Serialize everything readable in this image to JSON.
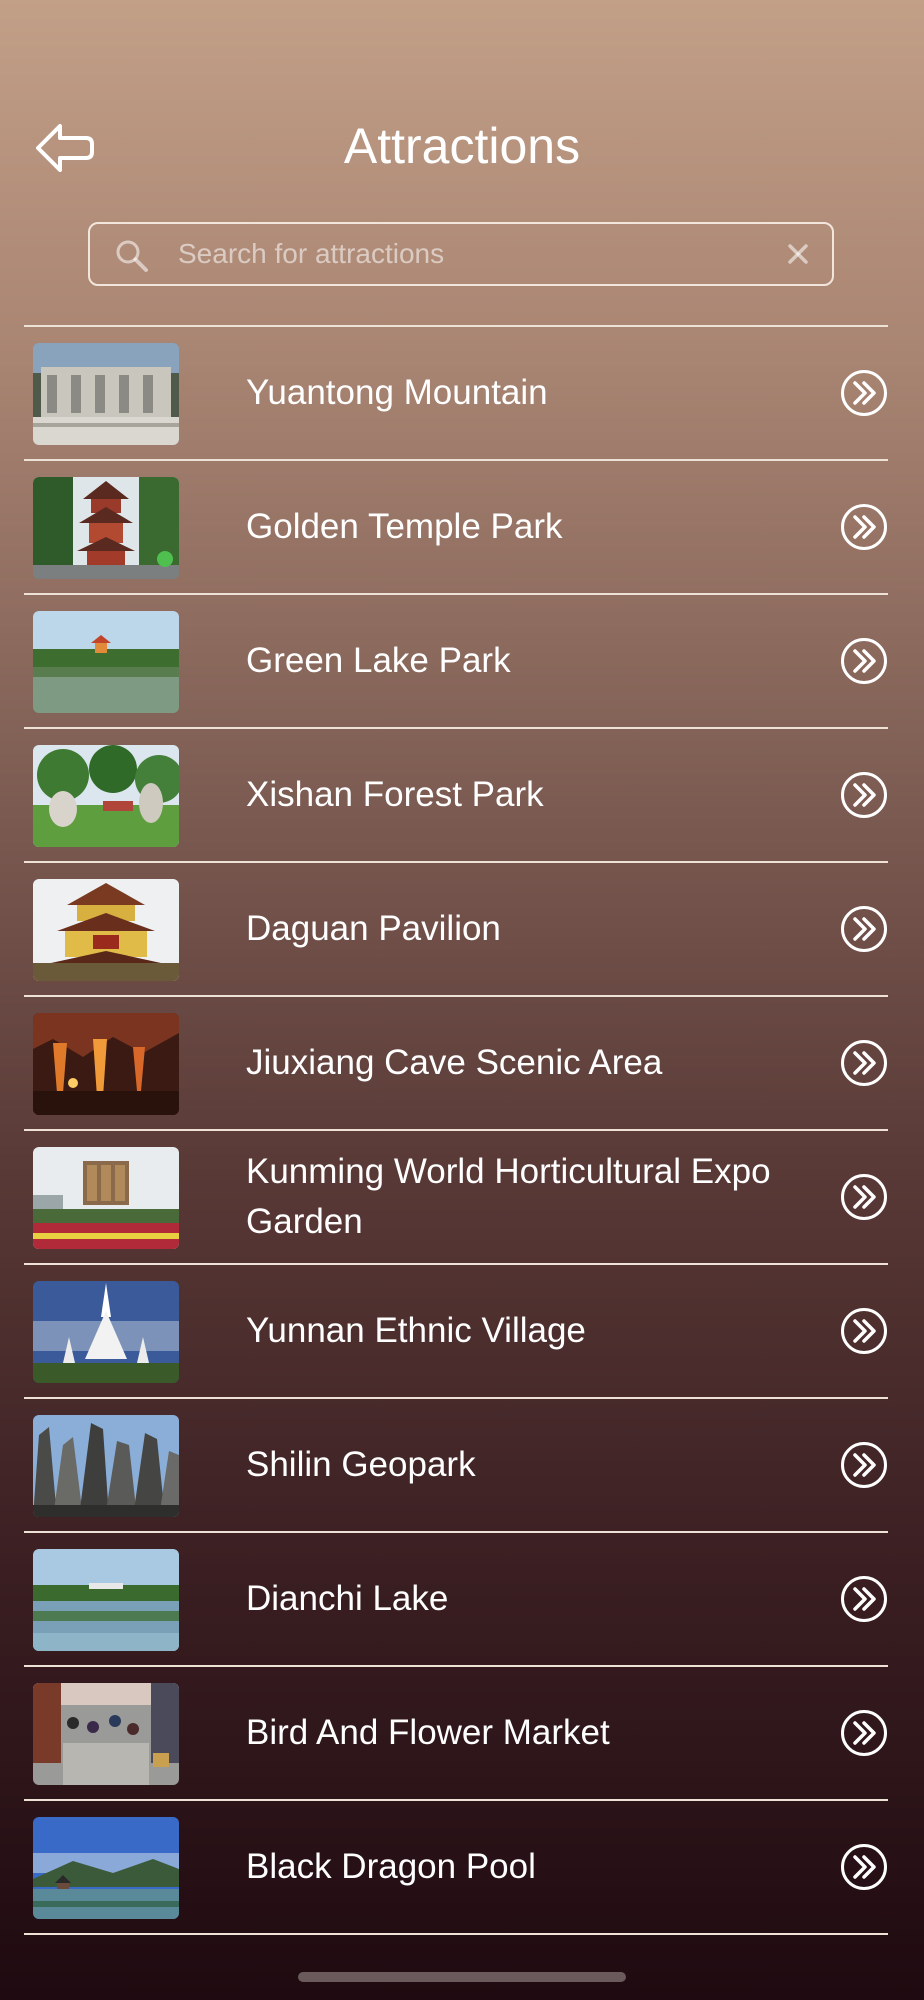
{
  "header": {
    "title": "Attractions",
    "back_icon": "back-arrow-icon"
  },
  "search": {
    "placeholder": "Search for attractions",
    "value": "",
    "icon": "search-icon",
    "clear_icon": "close-icon"
  },
  "attractions": [
    {
      "name": "Yuantong Mountain",
      "thumb": "temple-gate"
    },
    {
      "name": "Golden Temple Park",
      "thumb": "pagoda"
    },
    {
      "name": "Green Lake Park",
      "thumb": "lake"
    },
    {
      "name": "Xishan Forest Park",
      "thumb": "forest"
    },
    {
      "name": "Daguan Pavilion",
      "thumb": "pavilion"
    },
    {
      "name": "Jiuxiang Cave Scenic Area",
      "thumb": "cave"
    },
    {
      "name": "Kunming World Horticultural Expo Garden",
      "thumb": "expo"
    },
    {
      "name": "Yunnan Ethnic Village",
      "thumb": "white-pagoda"
    },
    {
      "name": "Shilin Geopark",
      "thumb": "stone-forest"
    },
    {
      "name": "Dianchi Lake",
      "thumb": "lake-bridge"
    },
    {
      "name": "Bird And Flower Market",
      "thumb": "market"
    },
    {
      "name": "Black Dragon Pool",
      "thumb": "pond"
    }
  ],
  "row_action_icon": "chevron-double-right-icon",
  "colors": {
    "background_top": "#c29f87",
    "background_bottom": "#1e0a10",
    "divider": "#eee2d6",
    "text": "#ffffff"
  }
}
